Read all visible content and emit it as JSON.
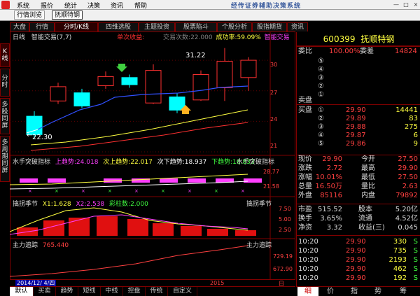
{
  "menu": {
    "items": [
      "系统",
      "报价",
      "统计",
      "决策",
      "资讯",
      "帮助"
    ],
    "title": "经传证券辅助决策系统",
    "win_min": "—",
    "win_max": "□",
    "win_close": "×"
  },
  "toolbar": {
    "buttons": [
      "行情浏览",
      "抚顺特钢"
    ]
  },
  "tabs": [
    "大盘",
    "行情",
    "分时/K线",
    "四维选股",
    "主题投资",
    "股票陷斗",
    "个股分析",
    "股指期货",
    "资讯"
  ],
  "side_tabs": [
    "K线",
    "分时",
    "多股同屏",
    "多周期同屏"
  ],
  "main_panel": {
    "period_label": "日线",
    "indicator_name": "智能交易(7,7)",
    "label_a": "单次收益:",
    "label_b": "交易次数:22.000",
    "label_c": "成功率:59.09%",
    "label_d": "智能交易",
    "high_label": "31.22",
    "low_label": "22.30",
    "y_ticks": [
      "30",
      "27",
      "24",
      "21"
    ]
  },
  "panel2": {
    "name": "水手突破指标",
    "up": "上趋势:24.018",
    "next_up": "次上趋势:22.017",
    "next_down": "次下趋势:18.937",
    "down": "下趋势:16.833",
    "right_label": "水手突破指标",
    "y_ticks": [
      "28.77",
      "21.58"
    ]
  },
  "panel3": {
    "name": "擒拐季节",
    "x1": "X1:1.628",
    "x2": "X2:2.538",
    "color_label": "彩柱数:2.000",
    "right_label": "擒拐季节",
    "y_ticks": [
      "7.50",
      "5.00",
      "2.50"
    ]
  },
  "panel4": {
    "name": "主力追踪",
    "value": "765.440",
    "right_label": "主力追踪",
    "y_ticks": [
      "729.19",
      "672.90"
    ]
  },
  "date_label": "2014/12/ 4/四",
  "date_right": "2015",
  "chart_data": {
    "type": "candlestick",
    "candles": [
      {
        "o": 24.5,
        "c": 22.7,
        "h": 25.0,
        "l": 22.3
      },
      {
        "o": 26.0,
        "c": 27.4,
        "h": 27.8,
        "l": 25.7
      },
      {
        "o": 26.8,
        "c": 25.5,
        "h": 27.2,
        "l": 25.3
      },
      {
        "o": 27.5,
        "c": 28.4,
        "h": 28.9,
        "l": 27.2
      },
      {
        "o": 28.3,
        "c": 27.6,
        "h": 28.6,
        "l": 27.3
      },
      {
        "o": 25.8,
        "c": 29.0,
        "h": 29.6,
        "l": 25.7
      },
      {
        "o": 26.4,
        "c": 25.1,
        "h": 26.8,
        "l": 24.8
      },
      {
        "o": 26.1,
        "c": 28.6,
        "h": 29.0,
        "l": 26.0
      },
      {
        "o": 27.3,
        "c": 29.9,
        "h": 31.2,
        "l": 26.0
      },
      {
        "o": 28.3,
        "c": 30.0,
        "h": 30.3,
        "l": 27.0
      }
    ],
    "ylim": [
      21,
      32
    ]
  },
  "stock": {
    "code": "600399",
    "name": "抚顺特钢",
    "wb_label": "委比",
    "wb_value": "100.00%",
    "wc_label": "委差",
    "wc_value": "14824",
    "sell_label": "卖盘",
    "sell_rows": [
      "⑤",
      "④",
      "③",
      "②",
      "①"
    ],
    "buy_label": "买盘",
    "buy_rows": [
      {
        "n": "①",
        "price": "29.90",
        "vol": "14441"
      },
      {
        "n": "②",
        "price": "29.89",
        "vol": "83"
      },
      {
        "n": "③",
        "price": "29.88",
        "vol": "275"
      },
      {
        "n": "④",
        "price": "29.87",
        "vol": "6"
      },
      {
        "n": "⑤",
        "price": "29.86",
        "vol": "9"
      }
    ],
    "quote": [
      {
        "l1": "现价",
        "v1": "29.90",
        "l2": "今开",
        "v2": "27.50"
      },
      {
        "l1": "涨跌",
        "v1": "2.72",
        "l2": "最高",
        "v2": "29.90"
      },
      {
        "l1": "涨幅",
        "v1": "10.01%",
        "l2": "最低",
        "v2": "27.50"
      },
      {
        "l1": "总量",
        "v1": "16.50万",
        "l2": "量比",
        "v2": "2.63"
      },
      {
        "l1": "外盘",
        "v1": "85116",
        "l2": "内盘",
        "v2": "79892"
      }
    ],
    "fin": [
      {
        "l1": "市盈",
        "v1": "515.52",
        "l2": "股本",
        "v2": "5.20亿"
      },
      {
        "l1": "换手",
        "v1": "3.65%",
        "l2": "流通",
        "v2": "4.52亿"
      },
      {
        "l1": "净资",
        "v1": "3.32",
        "l2": "收益(三)",
        "v2": "0.045"
      }
    ],
    "ticks": [
      {
        "t": "10:20",
        "p": "29.90",
        "v": "330",
        "s": "S"
      },
      {
        "t": "10:20",
        "p": "29.90",
        "v": "735",
        "s": "S"
      },
      {
        "t": "10:20",
        "p": "29.90",
        "v": "2193",
        "s": "S"
      },
      {
        "t": "10:20",
        "p": "29.90",
        "v": "462",
        "s": "S"
      },
      {
        "t": "10:20",
        "p": "29.90",
        "v": "192",
        "s": "S"
      }
    ]
  },
  "bottom_tabs": [
    "默认",
    "买卖",
    "趋势",
    "短线",
    "中线",
    "控盘",
    "传统",
    "自定义"
  ],
  "right_bottom_tabs": [
    "细",
    "价",
    "指",
    "势",
    "筹"
  ],
  "bottom_left_label": "日线"
}
